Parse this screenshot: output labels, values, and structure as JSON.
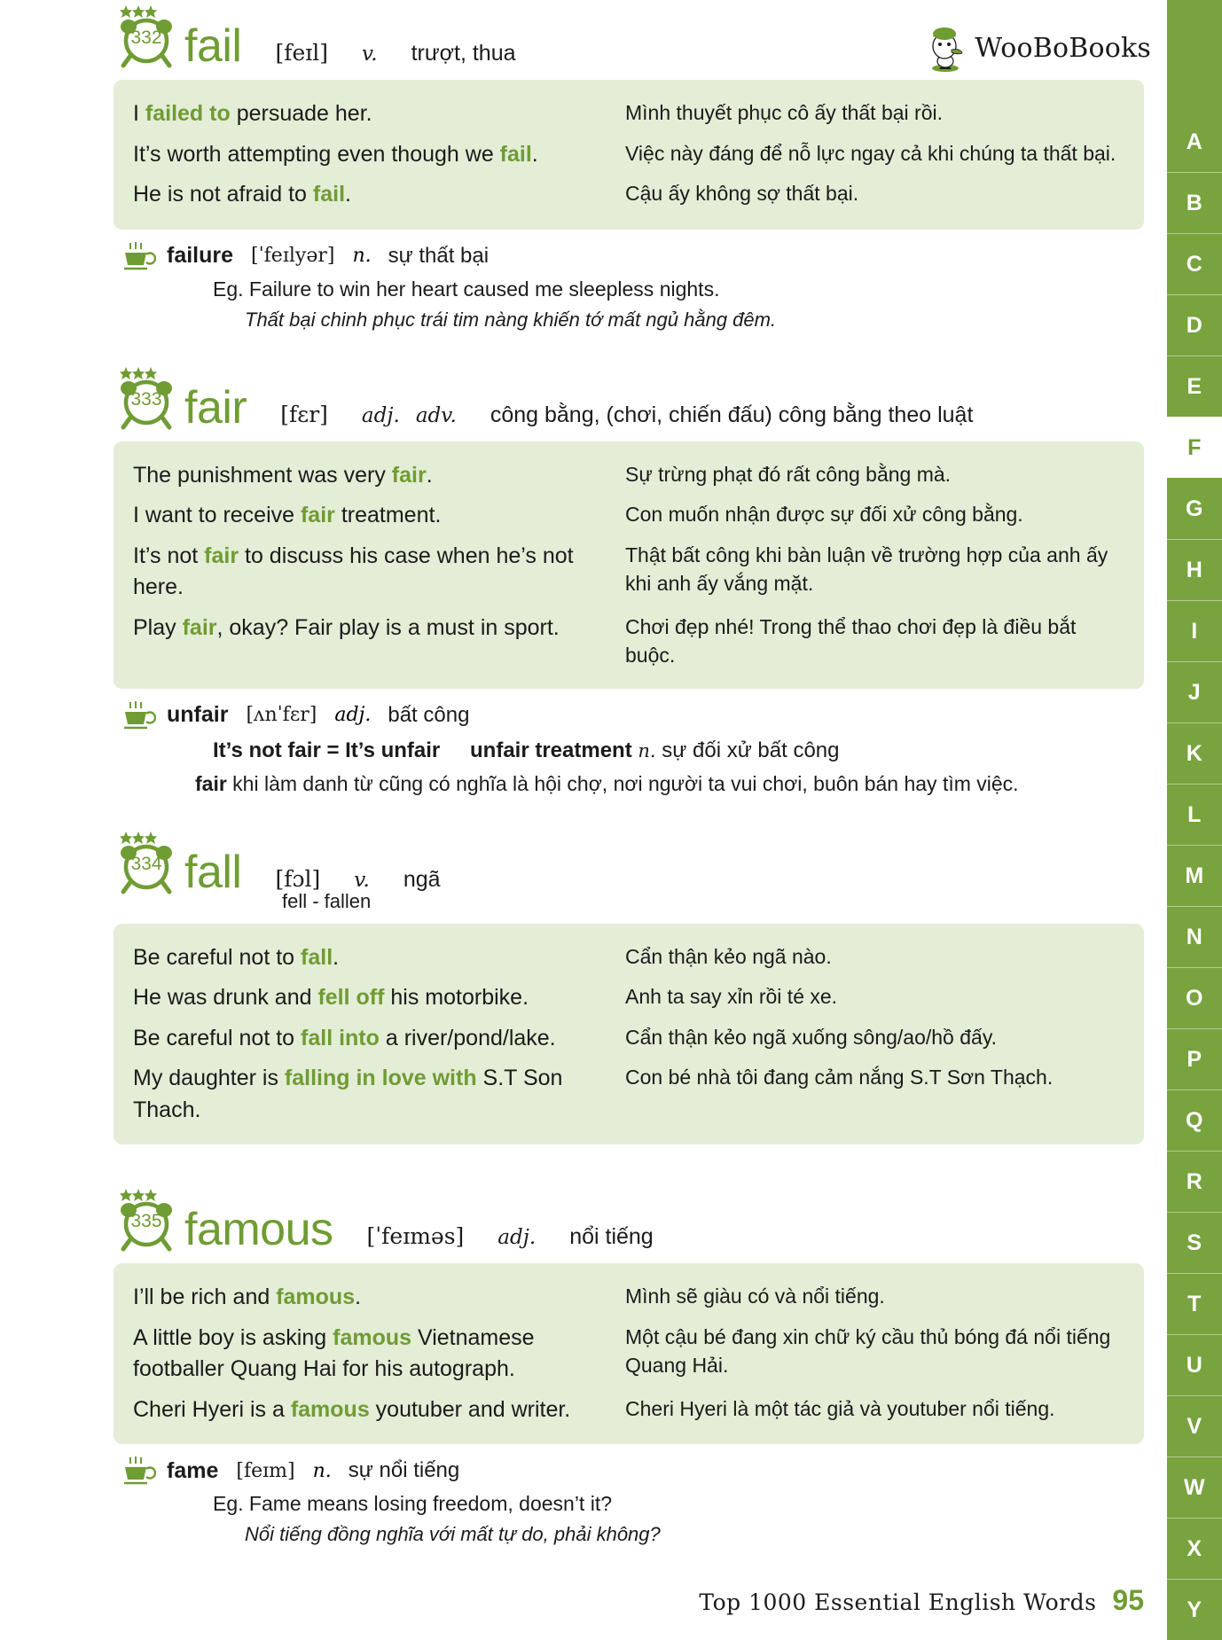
{
  "brand": {
    "name": "WooBoBooks",
    "logo_icon": "woobo-mascot-icon"
  },
  "theme": {
    "green": "#6F9C33",
    "rail": "#78A33E",
    "box": "#E4EDD6"
  },
  "alphabet": {
    "active": "F",
    "letters": [
      "A",
      "B",
      "C",
      "D",
      "E",
      "F",
      "G",
      "H",
      "I",
      "J",
      "K",
      "L",
      "M",
      "N",
      "O",
      "P",
      "Q",
      "R",
      "S",
      "T",
      "U",
      "V",
      "W",
      "X",
      "Y"
    ]
  },
  "entries": [
    {
      "number": "332",
      "stars": 3,
      "word": "fail",
      "phonetic": "[feɪl]",
      "pos": "v.",
      "pos2": "",
      "meaning": "trượt, thua",
      "irregular": "",
      "examples": [
        {
          "en_pre": "I ",
          "en_hl": "failed to",
          "en_post": " persuade her.",
          "vi": "Mình thuyết phục cô ấy thất bại rồi."
        },
        {
          "en_pre": "It’s worth attempting even though we ",
          "en_hl": "fail",
          "en_post": ".",
          "vi": "Việc này đáng để nỗ lực ngay cả khi chúng ta thất bại."
        },
        {
          "en_pre": "He is not afraid to ",
          "en_hl": "fail",
          "en_post": ".",
          "vi": "Cậu ấy không sợ thất bại."
        }
      ],
      "sub": {
        "icon": "coffee-cup-icon",
        "word": "failure",
        "phonetic": "[ˈfeɪlyər]",
        "pos": "n.",
        "meaning": "sự thất bại",
        "eg": "Eg.  Failure to win her heart caused me sleepless nights.",
        "eg_vi": "Thất bại chinh phục trái tim nàng khiến tớ mất ngủ hằng đêm."
      }
    },
    {
      "number": "333",
      "stars": 3,
      "word": "fair",
      "phonetic": "[fɛr]",
      "pos": "adj.",
      "pos2": "adv.",
      "meaning": "công bằng, (chơi, chiến đấu) công bằng theo luật",
      "irregular": "",
      "examples": [
        {
          "en_pre": "The punishment was very ",
          "en_hl": "fair",
          "en_post": ".",
          "vi": "Sự trừng phạt đó rất công bằng mà."
        },
        {
          "en_pre": "I want to receive ",
          "en_hl": "fair",
          "en_post": " treatment.",
          "vi": "Con muốn nhận được sự đối xử công bằng."
        },
        {
          "en_pre": "It’s not ",
          "en_hl": "fair",
          "en_post": " to discuss his case when he’s not here.",
          "vi": "Thật bất công khi bàn luận về trường hợp của anh ấy khi anh ấy vắng mặt."
        },
        {
          "en_pre": "Play ",
          "en_hl": "fair",
          "en_post": ", okay? Fair play is a must in sport.",
          "vi": "Chơi đẹp nhé! Trong thể thao chơi đẹp là điều bắt buộc."
        }
      ],
      "sub": {
        "icon": "coffee-cup-icon",
        "word": "unfair",
        "phonetic": "[ʌnˈfɛr]",
        "pos": "adj.",
        "meaning": "bất công",
        "note_a": "It’s not fair = It’s unfair",
        "note_b_bold": "unfair treatment",
        "note_b_pos": "n.",
        "note_b_rest": "sự đối xử bất công",
        "note_word": "fair",
        "note_text": " khi làm danh từ cũng có nghĩa là hội chợ, nơi người ta vui chơi, buôn bán hay tìm việc."
      }
    },
    {
      "number": "334",
      "stars": 3,
      "word": "fall",
      "phonetic": "[fɔl]",
      "pos": "v.",
      "pos2": "",
      "meaning": "ngã",
      "irregular": "fell - fallen",
      "examples": [
        {
          "en_pre": "Be careful not to ",
          "en_hl": "fall",
          "en_post": ".",
          "vi": "Cẩn thận kẻo ngã nào."
        },
        {
          "en_pre": "He was drunk and ",
          "en_hl": "fell off",
          "en_post": " his motorbike.",
          "vi": "Anh ta say xỉn rồi té xe."
        },
        {
          "en_pre": "Be careful not to ",
          "en_hl": "fall into",
          "en_post": " a river/pond/lake.",
          "vi": "Cẩn thận kẻo ngã xuống sông/ao/hồ đấy."
        },
        {
          "en_pre": "My daughter is ",
          "en_hl": "falling in love with",
          "en_post": " S.T Son Thach.",
          "vi": "Con bé nhà tôi đang cảm nắng S.T Sơn Thạch."
        }
      ],
      "sub": null
    },
    {
      "number": "335",
      "stars": 3,
      "word": "famous",
      "phonetic": "[ˈfeɪməs]",
      "pos": "adj.",
      "pos2": "",
      "meaning": "nổi tiếng",
      "irregular": "",
      "examples": [
        {
          "en_pre": "I’ll be rich and ",
          "en_hl": "famous",
          "en_post": ".",
          "vi": "Mình sẽ giàu có và nổi tiếng."
        },
        {
          "en_pre": "A little boy is asking ",
          "en_hl": "famous",
          "en_post": " Vietnamese footballer Quang Hai for his autograph.",
          "vi": "Một cậu bé đang xin chữ ký cầu thủ bóng đá nổi tiếng Quang Hải."
        },
        {
          "en_pre": "Cheri Hyeri is a ",
          "en_hl": "famous",
          "en_post": " youtuber and writer.",
          "vi": "Cheri Hyeri là một tác giả và youtuber nổi tiếng."
        }
      ],
      "sub": {
        "icon": "coffee-cup-icon",
        "word": "fame",
        "phonetic": "[feɪm]",
        "pos": "n.",
        "meaning": "sự nổi tiếng",
        "eg": "Eg.  Fame means losing freedom, doesn’t it?",
        "eg_vi": "Nổi tiếng đồng nghĩa với mất tự do, phải không?"
      }
    }
  ],
  "footer": {
    "title": "Top 1000 Essential English Words",
    "page": "95"
  }
}
